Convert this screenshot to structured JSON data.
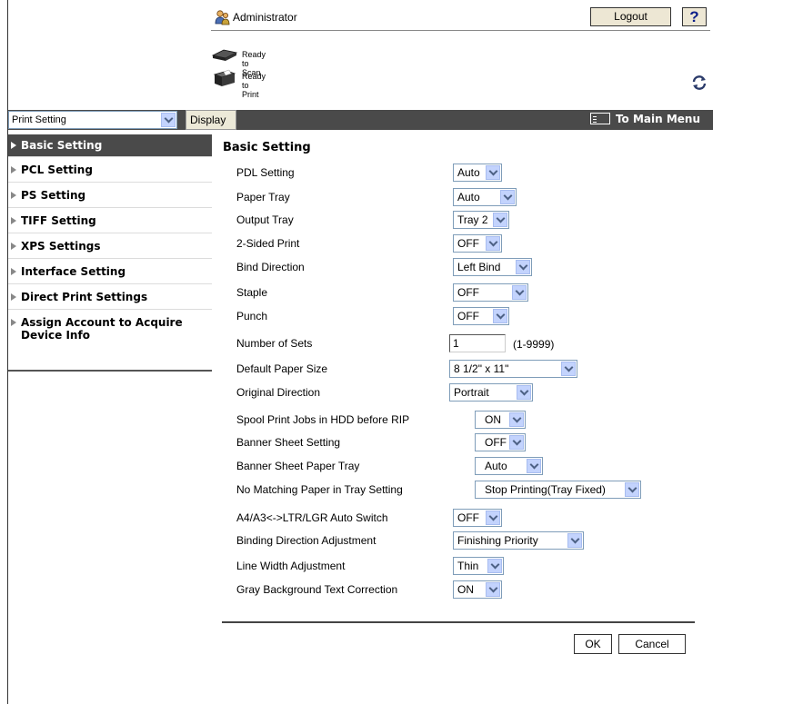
{
  "header": {
    "user_label": "Administrator",
    "logout_label": "Logout",
    "help_label": "?"
  },
  "status": {
    "scan": "Ready to Scan",
    "print": "Ready to Print"
  },
  "topbar": {
    "page_select_value": "Print Setting",
    "display_label": "Display",
    "main_menu_label": "To Main Menu"
  },
  "sidebar": {
    "items": [
      {
        "label": "Basic Setting",
        "active": true
      },
      {
        "label": "PCL Setting"
      },
      {
        "label": "PS Setting"
      },
      {
        "label": "TIFF Setting"
      },
      {
        "label": "XPS Settings"
      },
      {
        "label": "Interface Setting"
      },
      {
        "label": "Direct Print Settings"
      },
      {
        "label": "Assign Account to Acquire Device Info"
      }
    ]
  },
  "form": {
    "title": "Basic Setting",
    "fields": [
      {
        "label": "PDL Setting",
        "value": "Auto"
      },
      {
        "label": "Paper Tray",
        "value": "Auto"
      },
      {
        "label": "Output Tray",
        "value": "Tray 2"
      },
      {
        "label": "2-Sided Print",
        "value": "OFF"
      },
      {
        "label": "Bind Direction",
        "value": "Left Bind"
      },
      {
        "label": "Staple",
        "value": "OFF"
      },
      {
        "label": "Punch",
        "value": "OFF"
      },
      {
        "label": "Number of Sets",
        "value": "1",
        "range": "(1-9999)"
      },
      {
        "label": "Default Paper Size",
        "value": "8 1/2\" x 11\""
      },
      {
        "label": "Original Direction",
        "value": "Portrait"
      },
      {
        "label": "Spool Print Jobs in HDD before RIP",
        "value": "ON"
      },
      {
        "label": "Banner Sheet Setting",
        "value": "OFF"
      },
      {
        "label": "Banner Sheet Paper Tray",
        "value": "Auto"
      },
      {
        "label": "No Matching Paper in Tray Setting",
        "value": "Stop Printing(Tray Fixed)"
      },
      {
        "label": "A4/A3<->LTR/LGR Auto Switch",
        "value": "OFF"
      },
      {
        "label": "Binding Direction Adjustment",
        "value": "Finishing Priority"
      },
      {
        "label": "Line Width Adjustment",
        "value": "Thin"
      },
      {
        "label": "Gray Background Text Correction",
        "value": "ON"
      }
    ],
    "ok_label": "OK",
    "cancel_label": "Cancel"
  }
}
